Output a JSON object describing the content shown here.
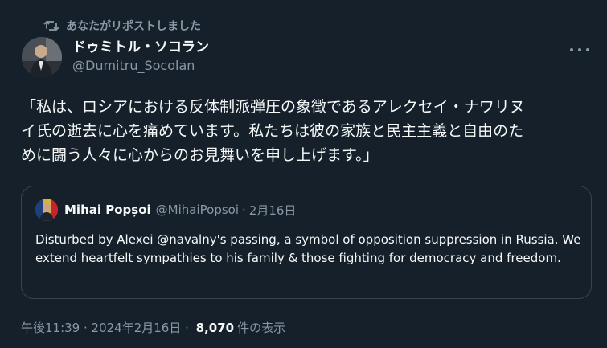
{
  "repost": {
    "label": "あなたがリポストしました"
  },
  "author": {
    "name": "ドゥミトル・ソコラン",
    "handle": "@Dumitru_Socolan"
  },
  "tweet": {
    "text": "「私は、ロシアにおける反体制派弾圧の象徴であるアレクセイ・ナワリヌ\nイ氏の逝去に心を痛めています。私たちは彼の家族と民主主義と自由のた\nめに闘う人々に心からのお見舞いを申し上げます。」"
  },
  "quote": {
    "name": "Mihai Popșoi",
    "handle": "@MihaiPopsoi",
    "separator": "·",
    "date": "2月16日",
    "text": "Disturbed by Alexei @navalny's passing, a symbol of opposition suppression in Russia. We extend heartfelt sympathies to his family & those fighting for democracy and freedom."
  },
  "meta": {
    "time": "午後11:39",
    "separator1": " · ",
    "date": "2024年2月16日",
    "separator2": " · ",
    "views_count": "8,070",
    "views_label": "件の表示"
  },
  "colors": {
    "background": "#15202b",
    "text": "#f7f9f9",
    "muted": "#8b98a5",
    "border": "#38444d"
  },
  "icons": {
    "repost": "repost-icon",
    "more": "more-icon"
  }
}
